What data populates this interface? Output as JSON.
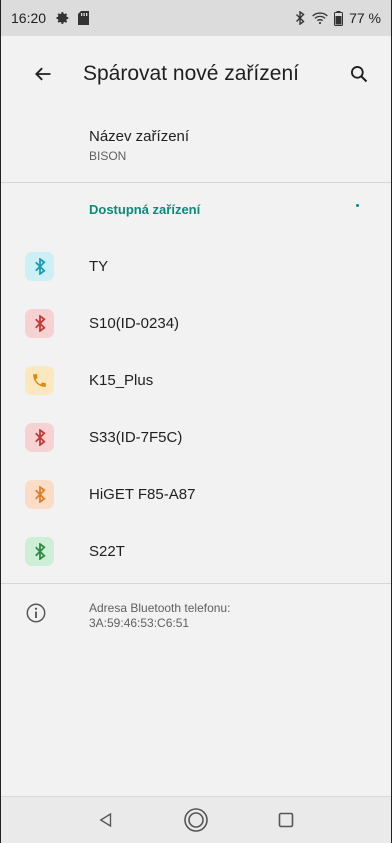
{
  "status_bar": {
    "time": "16:20",
    "battery": "77 %",
    "icons": [
      "gear-icon",
      "sd-card-icon",
      "bluetooth-icon",
      "wifi-icon",
      "battery-icon"
    ]
  },
  "app_bar": {
    "title": "Spárovat nové zařízení"
  },
  "device_name": {
    "label": "Název zařízení",
    "value": "BISON"
  },
  "available": {
    "header": "Dostupná zařízení",
    "accent_color": "#0b8a7a",
    "devices": [
      {
        "label": "TY",
        "icon": "bluetooth-icon",
        "bg": "#cdeff6",
        "fg": "#1a9bb8"
      },
      {
        "label": "S10(ID-0234)",
        "icon": "bluetooth-icon",
        "bg": "#f6d2d2",
        "fg": "#c43a3a"
      },
      {
        "label": "K15_Plus",
        "icon": "phone-icon",
        "bg": "#fbe8bf",
        "fg": "#e08a12"
      },
      {
        "label": "S33(ID-7F5C)",
        "icon": "bluetooth-icon",
        "bg": "#f6d2d2",
        "fg": "#c43a3a"
      },
      {
        "label": "HiGET F85-A87",
        "icon": "bluetooth-icon",
        "bg": "#fbdcc6",
        "fg": "#e07f2a"
      },
      {
        "label": "S22T",
        "icon": "bluetooth-icon",
        "bg": "#cfeed6",
        "fg": "#2f8a44"
      }
    ]
  },
  "info": {
    "line1": "Adresa Bluetooth telefonu:",
    "line2": "3A:59:46:53:C6:51"
  }
}
